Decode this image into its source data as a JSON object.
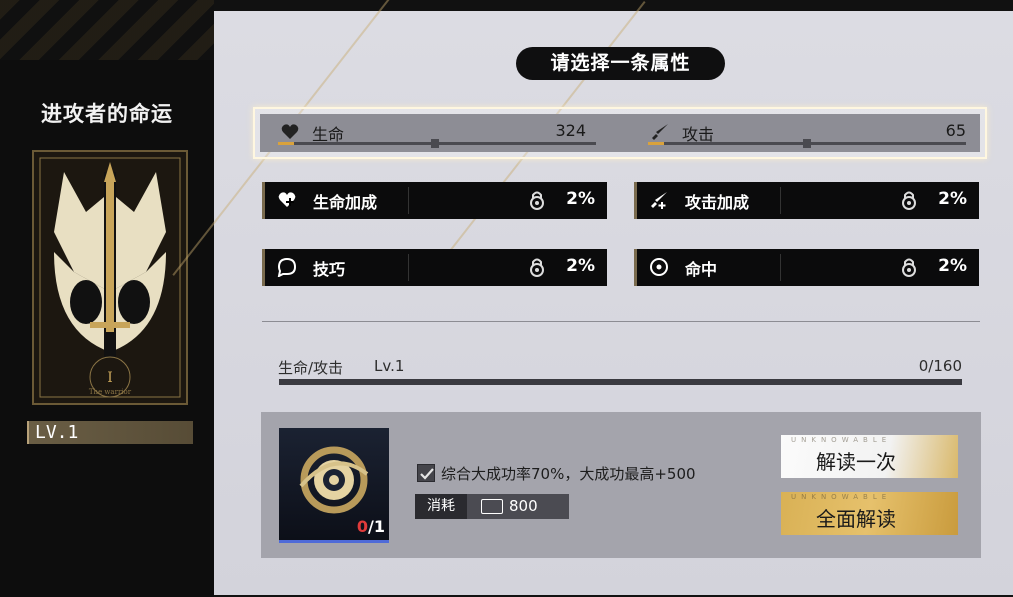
{
  "left": {
    "title": "进攻者的命运",
    "card_numeral": "I",
    "card_caption": "The warrior",
    "level": "LV.1"
  },
  "prompt": "请选择一条属性",
  "base_attributes": [
    {
      "name": "生命",
      "value": "324",
      "icon": "heart-icon",
      "progress": 0.05
    },
    {
      "name": "攻击",
      "value": "65",
      "icon": "sword-icon",
      "progress": 0.05
    }
  ],
  "attribute_options": [
    {
      "name": "生命加成",
      "value": "2%",
      "icon": "heart-plus-icon",
      "locked": true
    },
    {
      "name": "攻击加成",
      "value": "2%",
      "icon": "attack-boost-icon",
      "locked": true
    },
    {
      "name": "技巧",
      "value": "2%",
      "icon": "skill-icon",
      "locked": true
    },
    {
      "name": "命中",
      "value": "2%",
      "icon": "crosshair-icon",
      "locked": true
    }
  ],
  "progress": {
    "label": "生命/攻击",
    "level": "Lv.1",
    "count": "0/160",
    "fraction": 0.0
  },
  "item": {
    "count_have": "0",
    "count_sep": "/1",
    "icon": "eye-token-icon"
  },
  "option_text": "综合大成功率70%，大成功最高+500",
  "option_checked": true,
  "cost": {
    "label": "消耗",
    "amount": "800",
    "icon": "currency-icon"
  },
  "buttons": {
    "decode_once": "解读一次",
    "decode_all": "全面解读",
    "watermark": "UNKNOWABLE"
  },
  "colors": {
    "accent_gold": "#d9b155",
    "bar_fill": "#d9a23c",
    "item_border": "#4f6bd8",
    "count_red": "#e03b3b"
  }
}
